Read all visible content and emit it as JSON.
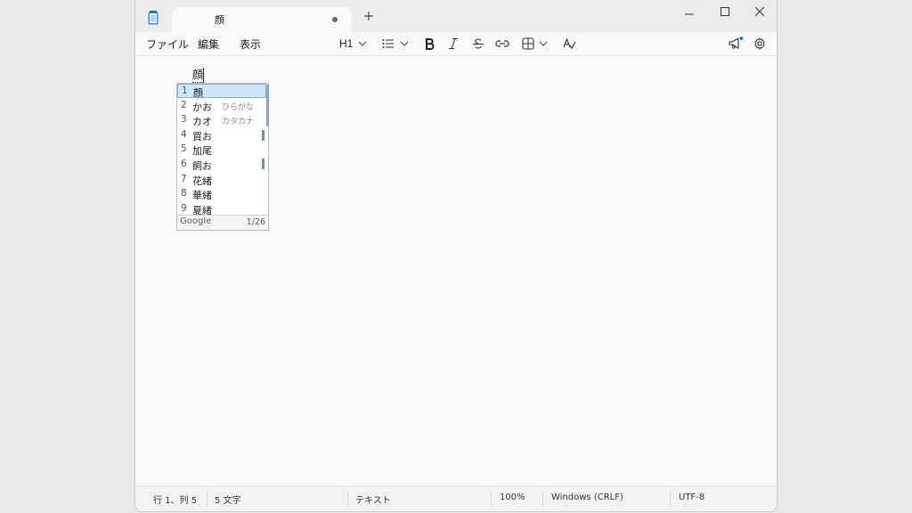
{
  "tab": {
    "title": "顔"
  },
  "menu": {
    "file": "ファイル",
    "edit": "編集",
    "view": "表示"
  },
  "toolbar": {
    "heading": "H1"
  },
  "editor": {
    "composing_text": "顔"
  },
  "ime": {
    "candidates": [
      {
        "num": "1",
        "text": "顔",
        "hint": ""
      },
      {
        "num": "2",
        "text": "かお",
        "hint": "ひらがな"
      },
      {
        "num": "3",
        "text": "カオ",
        "hint": "カタカナ"
      },
      {
        "num": "4",
        "text": "買お",
        "hint": ""
      },
      {
        "num": "5",
        "text": "加尾",
        "hint": ""
      },
      {
        "num": "6",
        "text": "飼お",
        "hint": ""
      },
      {
        "num": "7",
        "text": "花緒",
        "hint": ""
      },
      {
        "num": "8",
        "text": "華緒",
        "hint": ""
      },
      {
        "num": "9",
        "text": "夏緒",
        "hint": ""
      }
    ],
    "source": "Google",
    "page": "1/26"
  },
  "status": {
    "position": "行 1、列 5",
    "chars": "5 文字",
    "format": "テキスト",
    "zoom": "100%",
    "line_ending": "Windows (CRLF)",
    "encoding": "UTF-8"
  },
  "colors": {
    "selection": "#cfe6fb",
    "accent_dot": "#0067c0"
  }
}
